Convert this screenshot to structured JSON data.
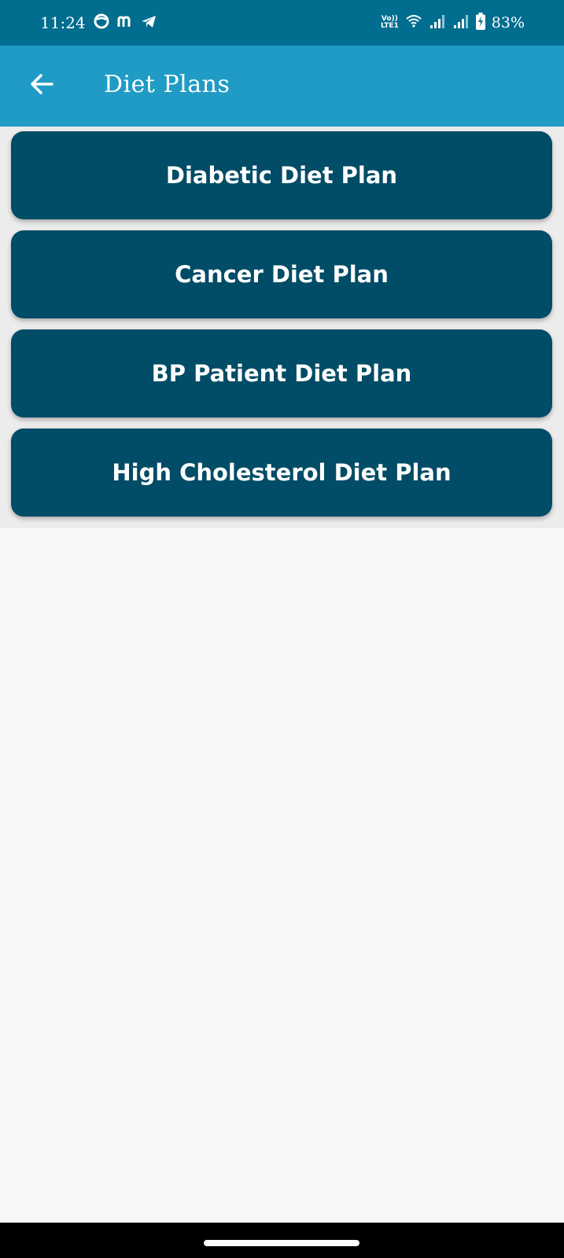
{
  "status_bar": {
    "time": "11:24",
    "battery_percent": "83%",
    "volte_label_top": "Vo))",
    "volte_label_bottom": "LTE1",
    "icons": [
      "camera-ring-icon",
      "messenger-m-icon",
      "telegram-icon",
      "volte-icon",
      "wifi-icon",
      "signal-icon",
      "signal-icon",
      "battery-charging-icon"
    ]
  },
  "app_bar": {
    "title": "Diet Plans",
    "back_icon": "arrow-left-icon"
  },
  "plans": [
    {
      "label": "Diabetic Diet Plan"
    },
    {
      "label": "Cancer Diet Plan"
    },
    {
      "label": "BP Patient Diet Plan"
    },
    {
      "label": "High Cholesterol Diet Plan"
    }
  ],
  "colors": {
    "status_bar": "#016d8f",
    "app_bar": "#1f9bc6",
    "card": "#014c66",
    "background": "#f8f8f8"
  }
}
